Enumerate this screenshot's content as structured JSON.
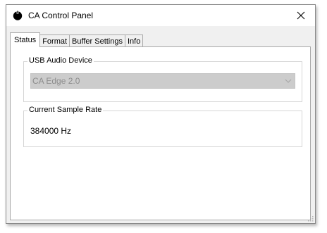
{
  "window": {
    "title": "CA Control Panel",
    "icon": "app-circle-icon",
    "close_icon": "close-icon"
  },
  "tabs": [
    {
      "label": "Status",
      "active": true
    },
    {
      "label": "Format",
      "active": false
    },
    {
      "label": "Buffer Settings",
      "active": false
    },
    {
      "label": "Info",
      "active": false
    }
  ],
  "status": {
    "usb_group_label": "USB Audio Device",
    "device_selected": "CA Edge 2.0",
    "device_enabled": false,
    "rate_group_label": "Current Sample Rate",
    "sample_rate": "384000 Hz"
  },
  "colors": {
    "window_bg": "#f0f0f0",
    "panel_bg": "#ffffff",
    "disabled_combo_bg": "#cccccc",
    "disabled_text": "#8d8d8d",
    "border": "#a9a9a9"
  }
}
